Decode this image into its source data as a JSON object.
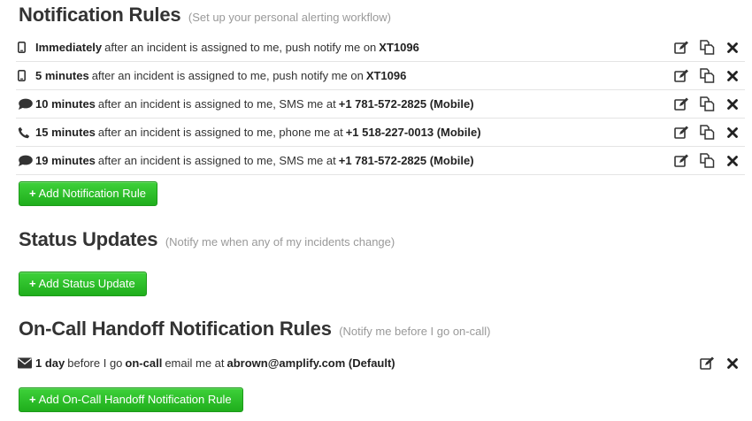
{
  "notification_rules": {
    "title": "Notification Rules",
    "subtitle": "(Set up your personal alerting workflow)",
    "rules": [
      {
        "icon": "mobile-phone-icon",
        "delay": "Immediately",
        "text": "after an incident is assigned to me, push notify me on",
        "target": "XT1096"
      },
      {
        "icon": "mobile-phone-icon",
        "delay": "5 minutes",
        "text": "after an incident is assigned to me, push notify me on",
        "target": "XT1096"
      },
      {
        "icon": "speech-bubble-icon",
        "delay": "10 minutes",
        "text": "after an incident is assigned to me, SMS me at",
        "target": "+1 781-572-2825 (Mobile)"
      },
      {
        "icon": "phone-handset-icon",
        "delay": "15 minutes",
        "text": "after an incident is assigned to me, phone me at",
        "target": "+1 518-227-0013 (Mobile)"
      },
      {
        "icon": "speech-bubble-icon",
        "delay": "19 minutes",
        "text": "after an incident is assigned to me, SMS me at",
        "target": "+1 781-572-2825 (Mobile)"
      }
    ],
    "add_button": "Add Notification Rule"
  },
  "status_updates": {
    "title": "Status Updates",
    "subtitle": "(Notify me when any of my incidents change)",
    "add_button": "Add Status Update"
  },
  "handoff_rules": {
    "title": "On-Call Handoff Notification Rules",
    "subtitle": "(Notify me before I go on-call)",
    "rule": {
      "icon": "envelope-icon",
      "delay": "1 day",
      "text_before": "before I go",
      "oncall": "on-call",
      "text_after": "email me at",
      "target": "abrown@amplify.com (Default)"
    },
    "add_button": "Add On-Call Handoff Notification Rule"
  },
  "button_plus": "+",
  "colors": {
    "button_green": "#2cc128",
    "divider": "#e4e4e4",
    "subtitle": "#999999"
  }
}
